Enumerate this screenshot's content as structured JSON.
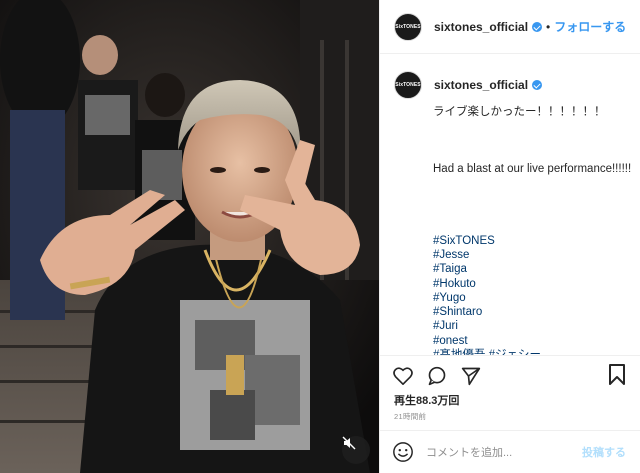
{
  "account": {
    "username": "sixtones_official",
    "avatar_text": "SixTONES",
    "follow_label": "フォローする",
    "separator": "•"
  },
  "caption": {
    "lines": [
      {
        "text": "ライブ楽しかったー！！！！！！",
        "type": "text"
      },
      {
        "text": "",
        "type": "blank"
      },
      {
        "text": "",
        "type": "blank"
      },
      {
        "text": "",
        "type": "blank"
      },
      {
        "text": "Had a blast at our live performance!!!!!!",
        "type": "text"
      },
      {
        "text": "",
        "type": "blank"
      },
      {
        "text": "",
        "type": "blank"
      },
      {
        "text": "",
        "type": "blank"
      },
      {
        "text": "",
        "type": "blank"
      },
      {
        "text": "#SixTONES",
        "type": "tag"
      },
      {
        "text": "#Jesse",
        "type": "tag"
      },
      {
        "text": "#Taiga",
        "type": "tag"
      },
      {
        "text": "#Hokuto",
        "type": "tag"
      },
      {
        "text": "#Yugo",
        "type": "tag"
      },
      {
        "text": "#Shintaro",
        "type": "tag"
      },
      {
        "text": "#Juri",
        "type": "tag"
      },
      {
        "text": "#onest",
        "type": "tag"
      },
      {
        "text": "#髙地優吾 #ジェシー",
        "type": "tag"
      }
    ]
  },
  "stats": {
    "views": "再生88.3万回",
    "time_ago": "21時間前"
  },
  "comment": {
    "placeholder": "コメントを追加...",
    "post_label": "投稿する"
  },
  "icons": {
    "like": "heart-icon",
    "comment": "comment-icon",
    "share": "share-icon",
    "save": "bookmark-icon",
    "mute": "sound-off-icon",
    "emoji": "smiley-icon"
  },
  "colors": {
    "link": "#3897f0",
    "hashtag": "#00376b",
    "muted": "#8e8e8e"
  }
}
